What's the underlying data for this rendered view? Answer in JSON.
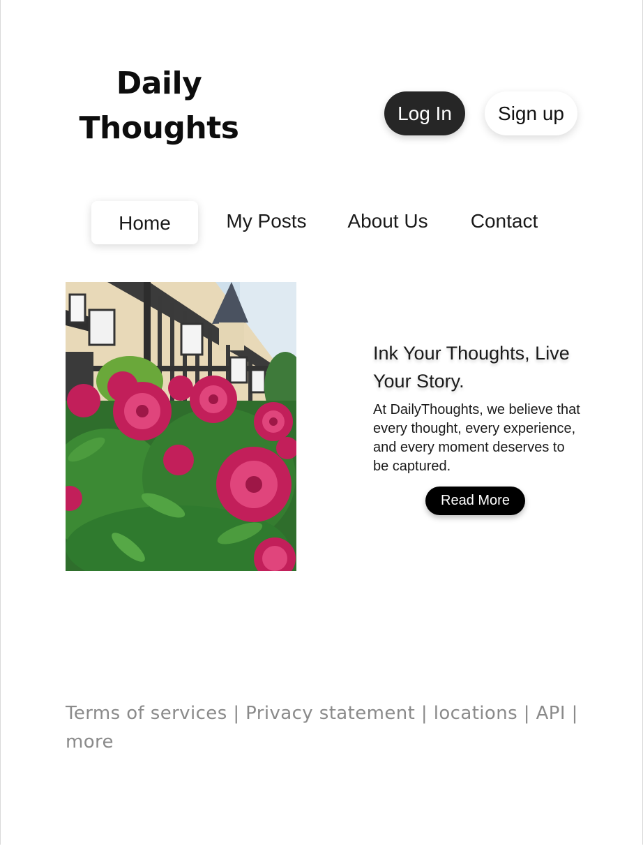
{
  "header": {
    "logo_line1": "Daily",
    "logo_line2": "Thoughts",
    "login_label": "Log In",
    "signup_label": "Sign up"
  },
  "nav": {
    "items": [
      {
        "label": "Home",
        "active": true
      },
      {
        "label": "My Posts"
      },
      {
        "label": "About Us"
      },
      {
        "label": "Contact"
      }
    ]
  },
  "hero": {
    "image_icon": "flower-house-photo",
    "heading": "Ink Your Thoughts, Live Your Story.",
    "body": "At DailyThoughts, we believe that every thought, every experience, and every moment deserves to be captured.",
    "read_more_label": "Read More"
  },
  "footer": {
    "links": [
      "Terms of services",
      "Privacy statement",
      "locations",
      "API",
      "more"
    ],
    "separator": "|"
  },
  "colors": {
    "login_bg": "#262626",
    "read_more_bg": "#000000",
    "footer_text": "#8a8a8a",
    "flower_magenta": "#c21f5a"
  }
}
